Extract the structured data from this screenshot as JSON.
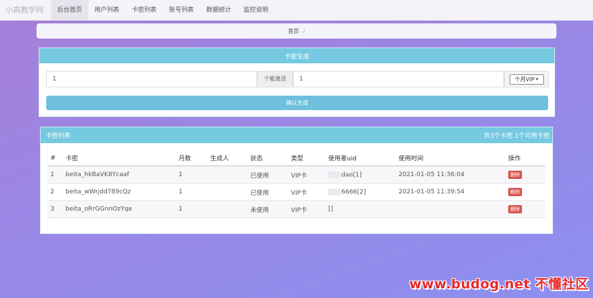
{
  "nav": {
    "brand": "小高教学网",
    "items": [
      "后台首页",
      "用户列表",
      "卡密列表",
      "账号列表",
      "数据统计",
      "监控说明"
    ]
  },
  "breadcrumb": {
    "home": "首页",
    "sep": "/"
  },
  "generator": {
    "title": "卡密生成",
    "count_value": "1",
    "count_suffix": "个能激活",
    "months_value": "1",
    "type_selected": "个月VIP",
    "submit_label": "确认生成"
  },
  "card_list": {
    "title": "卡密列表",
    "summary": "共3个卡密,1个可用卡密",
    "columns": [
      "#",
      "卡密",
      "月数",
      "生成人",
      "状态",
      "类型",
      "使用者uid",
      "使用时间",
      "操作"
    ],
    "rows": [
      {
        "idx": "1",
        "code": "beita_hkBaVK8Ycaaf",
        "months": "1",
        "creator": "",
        "status": "已使用",
        "type": "VIP卡",
        "uid": "dao[1]",
        "time": "2021-01-05 11:36:04",
        "action": "删除"
      },
      {
        "idx": "2",
        "code": "beita_wWrjdd789cQz",
        "months": "1",
        "creator": "",
        "status": "已使用",
        "type": "VIP卡",
        "uid": "6666[2]",
        "time": "2021-01-05 11:39:54",
        "action": "删除"
      },
      {
        "idx": "3",
        "code": "beita_oRrGGnnOzYqe",
        "months": "1",
        "creator": "",
        "status": "未使用",
        "type": "VIP卡",
        "uid": "[]",
        "time": "",
        "action": "删除"
      }
    ]
  },
  "watermark": "www.budog.net 不懂社区",
  "colors": {
    "accent": "#75c9e0",
    "danger": "#d9534f",
    "watermark": "#e8292b"
  }
}
